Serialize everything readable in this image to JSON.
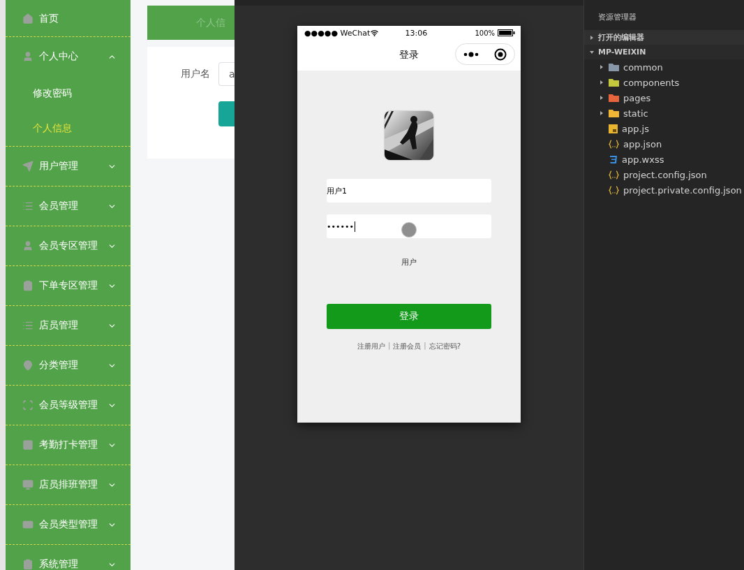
{
  "sidebar": {
    "items": [
      {
        "label": "首页",
        "kind": "link"
      },
      {
        "label": "个人中心",
        "kind": "group",
        "expanded": true,
        "children": [
          {
            "label": "修改密码",
            "selected": false
          },
          {
            "label": "个人信息",
            "selected": true
          }
        ]
      },
      {
        "label": "用户管理",
        "kind": "group",
        "expanded": false
      },
      {
        "label": "会员管理",
        "kind": "group",
        "expanded": false
      },
      {
        "label": "会员专区管理",
        "kind": "group",
        "expanded": false
      },
      {
        "label": "下单专区管理",
        "kind": "group",
        "expanded": false
      },
      {
        "label": "店员管理",
        "kind": "group",
        "expanded": false
      },
      {
        "label": "分类管理",
        "kind": "group",
        "expanded": false
      },
      {
        "label": "会员等级管理",
        "kind": "group",
        "expanded": false
      },
      {
        "label": "考勤打卡管理",
        "kind": "group",
        "expanded": false
      },
      {
        "label": "店员排班管理",
        "kind": "group",
        "expanded": false
      },
      {
        "label": "会员类型管理",
        "kind": "group",
        "expanded": false
      },
      {
        "label": "系统管理",
        "kind": "group",
        "expanded": false
      }
    ]
  },
  "main": {
    "header_title": "个人信",
    "form": {
      "label": "用户名",
      "value": "a"
    }
  },
  "phone": {
    "status": {
      "carrier": "●●●●● WeChat",
      "time": "13:06",
      "battery": "100%"
    },
    "nav_title": "登录",
    "username": {
      "value": "用户1"
    },
    "password": {
      "value": "••••••"
    },
    "role_label": "用户",
    "login_button": "登录",
    "links": [
      {
        "label": "注册用户",
        "kind": "link"
      },
      {
        "label": "|",
        "kind": "sep"
      },
      {
        "label": "注册会员",
        "kind": "link"
      },
      {
        "label": "|",
        "kind": "sep"
      },
      {
        "label": "忘记密码?",
        "kind": "link"
      }
    ]
  },
  "explorer": {
    "title": "资源管理器",
    "sections": [
      {
        "label": "打开的编辑器",
        "expanded": false
      },
      {
        "label": "MP-WEIXIN",
        "expanded": true,
        "children": [
          {
            "name": "common",
            "kind": "folder",
            "expanded": false,
            "color": "#8797a8"
          },
          {
            "name": "components",
            "kind": "folder",
            "expanded": false,
            "color": "#c3c83c"
          },
          {
            "name": "pages",
            "kind": "folder",
            "expanded": false,
            "color": "#e8643c"
          },
          {
            "name": "static",
            "kind": "folder",
            "expanded": false,
            "color": "#f2b637"
          },
          {
            "name": "app.js",
            "kind": "js"
          },
          {
            "name": "app.json",
            "kind": "json"
          },
          {
            "name": "app.wxss",
            "kind": "css"
          },
          {
            "name": "project.config.json",
            "kind": "json"
          },
          {
            "name": "project.private.config.json",
            "kind": "json"
          }
        ]
      }
    ]
  }
}
